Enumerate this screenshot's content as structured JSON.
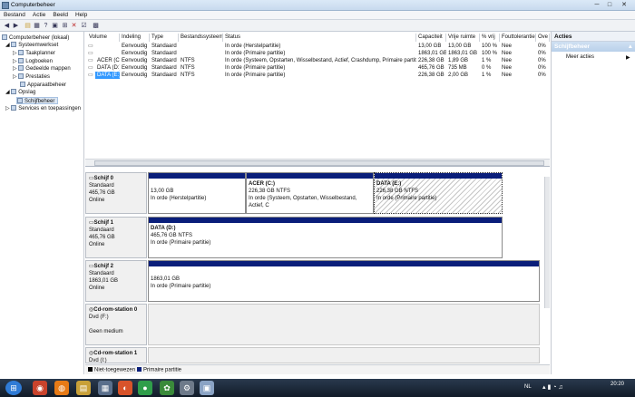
{
  "window": {
    "title": "Computerbeheer",
    "min": "─",
    "max": "□",
    "close": "✕"
  },
  "menu": [
    "Bestand",
    "Actie",
    "Beeld",
    "Help"
  ],
  "tree": {
    "root": "Computerbeheer (lokaal)",
    "systeem": "Systeemwerkset",
    "taak": "Taakplanner",
    "log": "Logboeken",
    "mappen": "Gedeelde mappen",
    "prest": "Prestaties",
    "appbeheer": "Apparaatbeheer",
    "opslag": "Opslag",
    "schijf": "Schijfbeheer",
    "services": "Services en toepassingen"
  },
  "table": {
    "headers": [
      "Volume",
      "Indeling",
      "Type",
      "Bestandssysteem",
      "Status",
      "Capaciteit",
      "Vrije ruimte",
      "% vrij",
      "Fouttolerantie",
      "Ove"
    ],
    "rows": [
      [
        "",
        "Eenvoudig",
        "Standaard",
        "",
        "In orde (Herstelpartitie)",
        "13,00 GB",
        "13,00 GB",
        "100 %",
        "Nee",
        "0%"
      ],
      [
        "",
        "Eenvoudig",
        "Standaard",
        "",
        "In orde (Primaire partitie)",
        "1863,01 GB",
        "1863,01 GB",
        "100 %",
        "Nee",
        "0%"
      ],
      [
        "ACER (C:)",
        "Eenvoudig",
        "Standaard",
        "NTFS",
        "In orde (Systeem, Opstarten, Wisselbestand, Actief, Crashdump, Primaire partitie)",
        "226,38 GB",
        "1,89 GB",
        "1 %",
        "Nee",
        "0%"
      ],
      [
        "DATA (D:)",
        "Eenvoudig",
        "Standaard",
        "NTFS",
        "In orde (Primaire partitie)",
        "465,76 GB",
        "735 MB",
        "0 %",
        "Nee",
        "0%"
      ],
      [
        "DATA (E:)",
        "Eenvoudig",
        "Standaard",
        "NTFS",
        "In orde (Primaire partitie)",
        "226,38 GB",
        "2,00 GB",
        "1 %",
        "Nee",
        "0%"
      ]
    ]
  },
  "disks": {
    "d0": {
      "name": "Schijf 0",
      "type": "Standaard",
      "size": "465,76 GB",
      "state": "Online",
      "p1": {
        "size": "13,00 GB",
        "status": "In orde (Herstelpartitie)"
      },
      "p2": {
        "name": "ACER  (C:)",
        "size": "226,38 GB NTFS",
        "status": "In orde (Systeem, Opstarten, Wisselbestand, Actief, C"
      },
      "p3": {
        "name": "DATA  (E:)",
        "size": "226,38 GB NTFS",
        "status": "In orde (Primaire partitie)"
      }
    },
    "d1": {
      "name": "Schijf 1",
      "type": "Standaard",
      "size": "465,76 GB",
      "state": "Online",
      "p1": {
        "name": "DATA  (D:)",
        "size": "465,76 GB NTFS",
        "status": "In orde (Primaire partitie)"
      }
    },
    "d2": {
      "name": "Schijf 2",
      "type": "Standaard",
      "size": "1863,01 GB",
      "state": "Online",
      "p1": {
        "size": "1863,01 GB",
        "status": "In orde (Primaire partitie)"
      }
    },
    "cd0": {
      "name": "Cd-rom-station 0",
      "type": "Dvd (F:)",
      "state": "Geen medium"
    },
    "cd1": {
      "name": "Cd-rom-station 1",
      "type": "Dvd (I:)"
    }
  },
  "legend": {
    "unalloc": "Niet-toegewezen",
    "primary": "Primaire partitie"
  },
  "actions": {
    "header": "Acties",
    "section": "Schijfbeheer",
    "more": "Meer acties"
  },
  "clock": {
    "time": "20:20",
    "lang": "NL"
  }
}
